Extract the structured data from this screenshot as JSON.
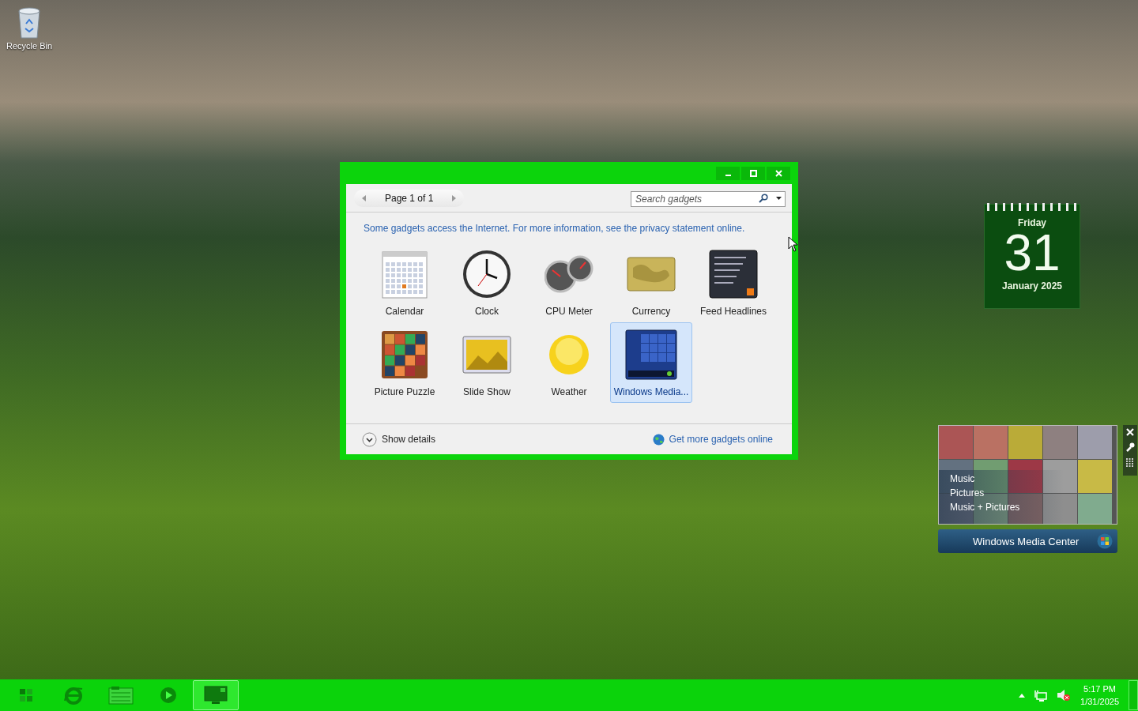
{
  "desktop": {
    "icons": [
      {
        "label": "Recycle Bin"
      }
    ]
  },
  "gadget_window": {
    "page_label": "Page 1 of 1",
    "search": {
      "placeholder": "Search gadgets"
    },
    "notice": "Some gadgets access the Internet.  For more information, see the privacy statement online.",
    "gadgets": [
      {
        "kind": "calendar",
        "label": "Calendar",
        "selected": false
      },
      {
        "kind": "clock",
        "label": "Clock",
        "selected": false
      },
      {
        "kind": "cpu",
        "label": "CPU Meter",
        "selected": false
      },
      {
        "kind": "currency",
        "label": "Currency",
        "selected": false
      },
      {
        "kind": "feed",
        "label": "Feed Headlines",
        "selected": false
      },
      {
        "kind": "puzzle",
        "label": "Picture Puzzle",
        "selected": false
      },
      {
        "kind": "slideshow",
        "label": "Slide Show",
        "selected": false
      },
      {
        "kind": "weather",
        "label": "Weather",
        "selected": false
      },
      {
        "kind": "media",
        "label": "Windows Media...",
        "selected": true
      }
    ],
    "show_details": "Show details",
    "online_link": "Get more gadgets online"
  },
  "calendar_gadget": {
    "weekday": "Friday",
    "day": "31",
    "month_year": "January 2025"
  },
  "media_center_gadget": {
    "menu": [
      "Music",
      "Pictures",
      "Music + Pictures"
    ],
    "title": "Windows Media Center"
  },
  "taskbar": {
    "apps": [
      {
        "kind": "start",
        "selected": false
      },
      {
        "kind": "browser",
        "selected": false
      },
      {
        "kind": "folder",
        "selected": false
      },
      {
        "kind": "player",
        "selected": false
      },
      {
        "kind": "gadgets",
        "selected": true
      }
    ],
    "clock": {
      "time": "5:17 PM",
      "date": "1/31/2025"
    }
  }
}
